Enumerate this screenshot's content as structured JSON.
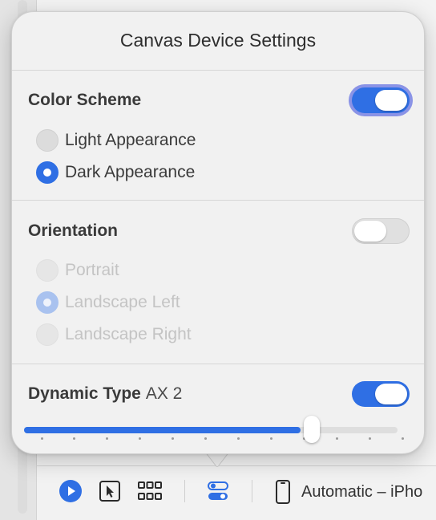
{
  "popover": {
    "title": "Canvas Device Settings",
    "color_scheme": {
      "title": "Color Scheme",
      "enabled": true,
      "options": [
        {
          "label": "Light Appearance",
          "selected": false
        },
        {
          "label": "Dark Appearance",
          "selected": true
        }
      ]
    },
    "orientation": {
      "title": "Orientation",
      "enabled": false,
      "options": [
        {
          "label": "Portrait",
          "selected": false
        },
        {
          "label": "Landscape Left",
          "selected": true
        },
        {
          "label": "Landscape Right",
          "selected": false
        }
      ]
    },
    "dynamic_type": {
      "title": "Dynamic Type",
      "value": "AX 2",
      "enabled": true,
      "slider_fraction": 0.74,
      "tick_count": 12
    }
  },
  "bottom_bar": {
    "icons": [
      "play-icon",
      "cursor-select-icon",
      "grid-icon",
      "device-settings-icon",
      "phone-icon"
    ],
    "device_label": "Automatic – iPho"
  },
  "colors": {
    "accent": "#2f6fe4",
    "focus_ring": "#8a93e6"
  }
}
